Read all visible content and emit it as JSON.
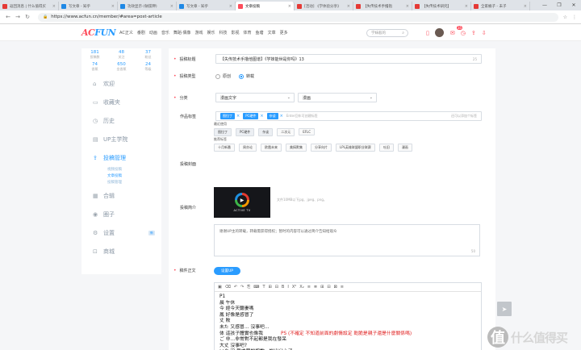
{
  "browser": {
    "tabs": [
      {
        "title": "返回消息 | 什么值得买",
        "color": "#e53935"
      },
      {
        "title": "写文章 - 知乎",
        "color": "#1e88e5"
      },
      {
        "title": "功效显示-(钠镁钾)",
        "color": "#1e88e5"
      },
      {
        "title": "写文章 - 知乎",
        "color": "#1e88e5"
      },
      {
        "title": "文章投稿",
        "color": "#fd4c5b"
      },
      {
        "title": "[活动] 《学体验分享》",
        "color": "#e53935"
      },
      {
        "title": "【失传技术手撸抱",
        "color": "#e53935"
      },
      {
        "title": "【失传技术研究】",
        "color": "#e53935"
      },
      {
        "title": "全家桶子 - 未子",
        "color": "#e53935"
      }
    ],
    "active_tab": 4,
    "url": "https://www.acfun.cn/member/#area=post-article",
    "window_controls": [
      "—",
      "❐",
      "✕"
    ]
  },
  "site": {
    "logo_a": "AC",
    "logo_b": "FUN",
    "menu": [
      "AC正义",
      "番剧",
      "动画",
      "音乐",
      "舞蹈·偶像",
      "游戏",
      "娱乐",
      "科技",
      "影视",
      "体育",
      "鱼塘",
      "文章",
      "更多"
    ],
    "search_placeholder": "学妹般的",
    "notif_count": "35"
  },
  "sidebar": {
    "stats": [
      {
        "num": "181",
        "label": "投稿数"
      },
      {
        "num": "48",
        "label": "关注"
      },
      {
        "num": "37",
        "label": "粉丝"
      },
      {
        "num": "74",
        "label": "香蕉"
      },
      {
        "num": "650",
        "label": "金香蕉"
      },
      {
        "num": "24",
        "label": "等级"
      }
    ],
    "items": [
      {
        "label": "欢迎",
        "icon": "home-icon"
      },
      {
        "label": "收藏夹",
        "icon": "folder-icon"
      },
      {
        "label": "历史",
        "icon": "clock-icon"
      },
      {
        "label": "UP主学院",
        "icon": "document-icon"
      },
      {
        "label": "投稿管理",
        "icon": "upload-icon"
      },
      {
        "label": "合辑",
        "icon": "collection-icon"
      },
      {
        "label": "圈子",
        "icon": "circle-icon"
      },
      {
        "label": "设置",
        "icon": "gear-icon",
        "tag": "新"
      },
      {
        "label": "商城",
        "icon": "shop-icon"
      }
    ],
    "subitems": [
      "视频投稿",
      "文章投稿",
      "投稿管理"
    ]
  },
  "form": {
    "title_label": "投稿标题",
    "title_value": "【失传技术手撸他图谱】《学妹能世是你吗》13",
    "title_count": "25",
    "type_label": "投稿类型",
    "type_options": [
      "原创",
      "转载"
    ],
    "category_label": "分类",
    "category_1": "漫画文字",
    "category_2": "漫画",
    "tags_label": "作品标签",
    "tags": [
      "图拉丁",
      "PC硬件",
      "杂谈"
    ],
    "tags_placeholder": "Enter回车可创建标签",
    "tags_hint": "还可以添加个标签",
    "recent_label": "最近使用",
    "recent_tags": [
      "图拉丁",
      "PC硬件",
      "杂谈",
      "二次元",
      "EFLC"
    ],
    "recommend_label": "推荐标签",
    "recommend_tags": [
      "十月新番",
      "周亦论",
      "欧霞未来",
      "美搞默集",
      "分享向片",
      "LPL英雄联盟职业联赛",
      "吐旧",
      "漫画"
    ],
    "cover_label": "投稿封面",
    "cover_hint": "文件10MB以下jpg、jpeg、png。",
    "cover_brand": "ACTIVE TV",
    "summary_label": "投稿简介",
    "summary_placeholder": "谢谢UP主的转载，转载需获得授权；暂时的内容可以通过简介告知给观众",
    "summary_count": "50",
    "body_label": "稿件正文",
    "set_button": "设置UP",
    "toolbar": [
      "▣",
      "⌫",
      "↶",
      "↷",
      "⎘",
      "⌨",
      "T",
      "⊞",
      "⊟",
      "B",
      "I",
      "X²",
      "X₂",
      "≡",
      "≣",
      "⊞",
      "⊟",
      "⊠",
      "≡"
    ],
    "body_lines": [
      "P1",
      "晨 午休",
      "今 經今天聽妻嗎",
      "鳳 好像是感冒了",
      "丈 敗",
      "未た 又感冒… 沒事吧…",
      "体 這孩子體實也像我",
      "ご 非…非常對不起都是我在發呆",
      "大丈 沒事吧?",
      "いや 沒 我才要說抱歉，說出分心了"
    ],
    "ps_note": "PS (不確定 不知道前面的劇情設定 乾脆是親子還是什麼關係嗎)"
  },
  "watermark": "什么值得买"
}
